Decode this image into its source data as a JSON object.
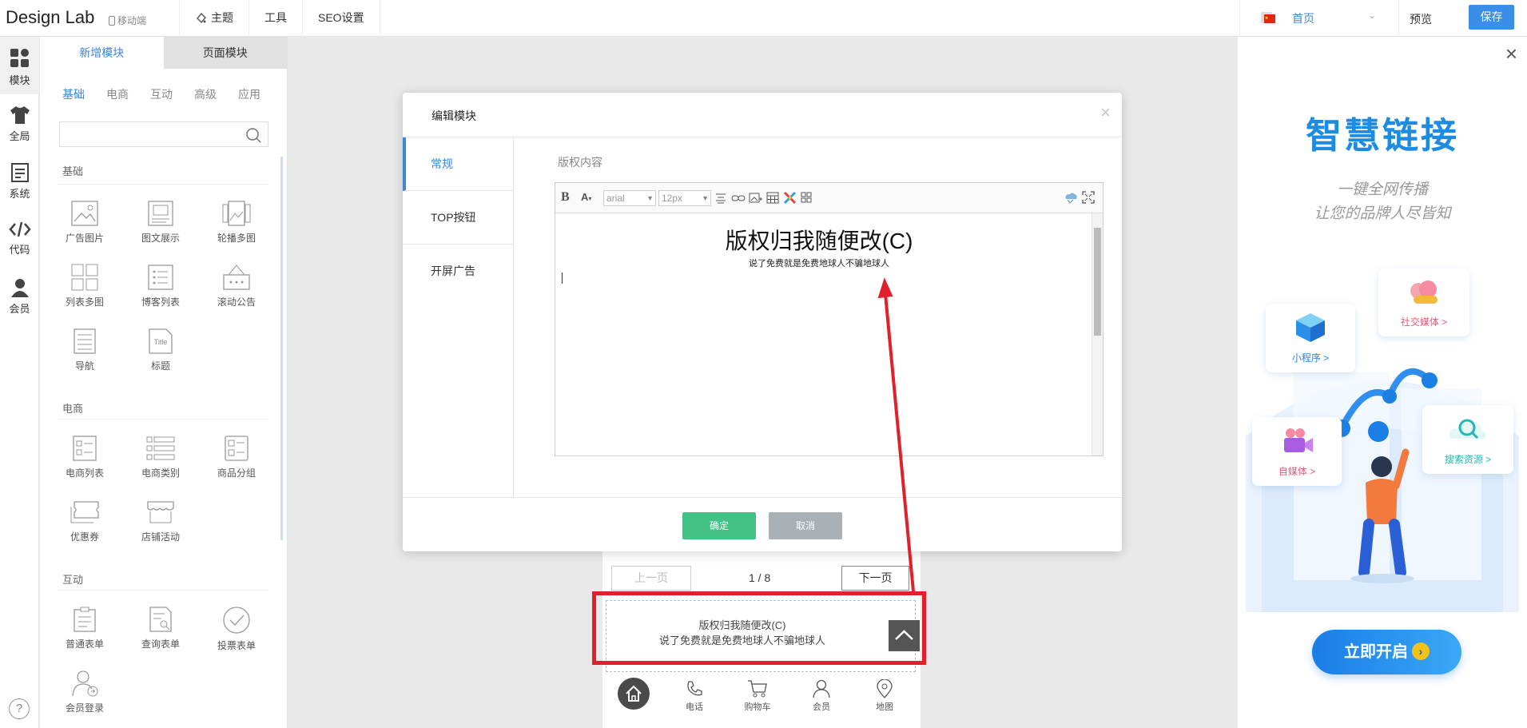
{
  "app": {
    "brand": "Design Lab",
    "mobile_tag": "移动端"
  },
  "topnav": [
    "主题",
    "工具",
    "SEO设置"
  ],
  "page_select": {
    "label": "首页"
  },
  "actions": {
    "preview": "预览",
    "save": "保存"
  },
  "rail": [
    {
      "label": "模块"
    },
    {
      "label": "全局"
    },
    {
      "label": "系统"
    },
    {
      "label": "代码"
    },
    {
      "label": "会员"
    }
  ],
  "help": "?",
  "panel": {
    "tabs": [
      "新增模块",
      "页面模块"
    ],
    "subtabs": [
      "基础",
      "电商",
      "互动",
      "高级",
      "应用"
    ],
    "sections": [
      {
        "title": "基础",
        "items": [
          "广告图片",
          "图文展示",
          "轮播多图",
          "列表多图",
          "博客列表",
          "滚动公告",
          "导航",
          "标题"
        ]
      },
      {
        "title": "电商",
        "items": [
          "电商列表",
          "电商类别",
          "商品分组",
          "优惠券",
          "店铺活动"
        ]
      },
      {
        "title": "互动",
        "items": [
          "普通表单",
          "查询表单",
          "投票表单",
          "会员登录"
        ]
      }
    ],
    "title_icon_text": "Title"
  },
  "phone": {
    "prev": "上一页",
    "page": "1 / 8",
    "next": "下一页",
    "footer_line1": "版权归我随便改(C)",
    "footer_line2": "说了免费就是免费地球人不骗地球人",
    "nav": [
      "电话",
      "购物车",
      "会员",
      "地图"
    ]
  },
  "modal": {
    "title": "编辑模块",
    "close": "×",
    "side": [
      "常规",
      "TOP按钮",
      "开屏广告"
    ],
    "field_label": "版权内容",
    "editor": {
      "font": "arial",
      "size": "12px",
      "line1": "版权归我随便改(C)",
      "line2": "说了免费就是免费地球人不骗地球人"
    },
    "ok": "确定",
    "cancel": "取消"
  },
  "ad": {
    "close": "×",
    "title": "智慧链接",
    "sub1": "一键全网传播",
    "sub2": "让您的品牌人尽皆知",
    "cards": [
      {
        "label": "社交媒体 >",
        "color": "#e8587a"
      },
      {
        "label": "小程序 >",
        "color": "#2a83dd"
      },
      {
        "label": "自媒体 >",
        "color": "#e8587a"
      },
      {
        "label": "搜索资源 >",
        "color": "#26b8b0"
      }
    ],
    "button": "立即开启",
    "button_icon": "›"
  },
  "colors": {
    "accent": "#3f86d6",
    "ok": "#44c285",
    "highlight": "#e0202a"
  }
}
